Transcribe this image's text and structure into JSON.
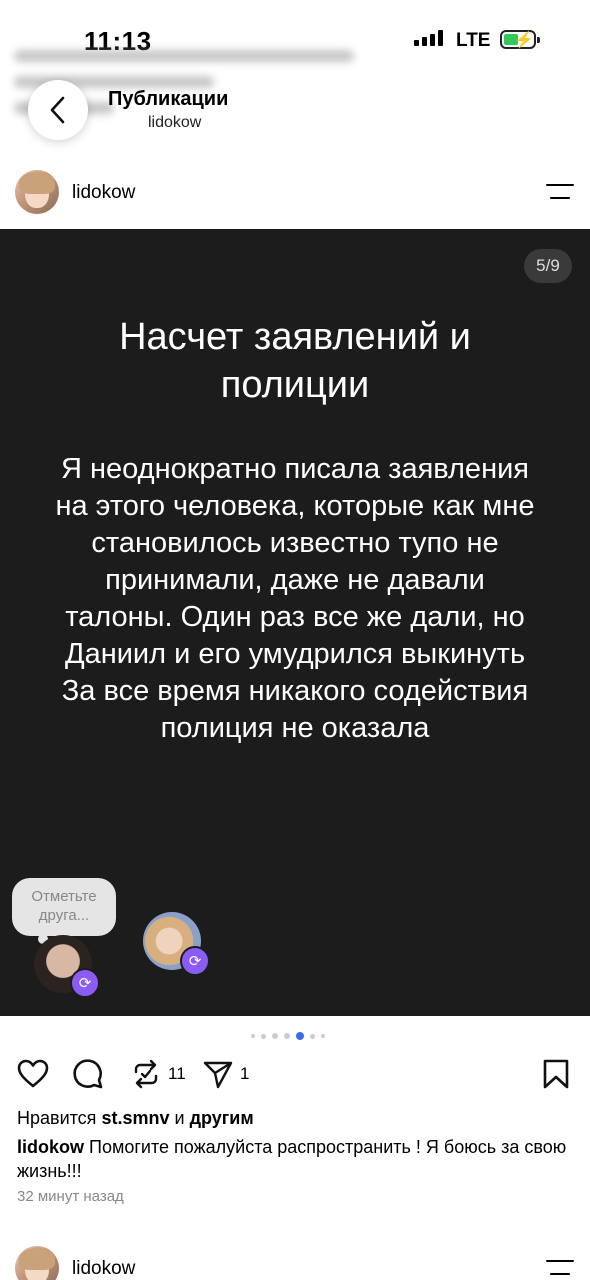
{
  "status_bar": {
    "time": "11:13",
    "network": "LTE"
  },
  "header": {
    "title": "Публикации",
    "subtitle": "lidokow"
  },
  "post": {
    "username": "lidokow",
    "slide": {
      "counter": "5/9",
      "title": "Насчет заявлений и полиции",
      "body": "Я неоднократно писала заявления на этого человека, которые как мне становилось известно тупо не принимали, даже не давали талоны. Один раз все же дали, но Даниил и его умудрился выкинуть За все время никакого содействия полиция не оказала",
      "tag_prompt": "Отметьте друга...",
      "current_slide": 5,
      "total_slides": 9
    },
    "actions": {
      "reposts": "11",
      "shares": "1"
    },
    "likes": {
      "prefix": "Нравится",
      "user": "st.smnv",
      "joiner": "и",
      "others": "другим"
    },
    "caption": {
      "author": "lidokow",
      "text": "Помогите пожалуйста распространить ! Я боюсь за свою жизнь!!!"
    },
    "time_ago": "32 минут назад"
  },
  "next_post": {
    "username": "lidokow"
  },
  "icons": [
    "back-chevron-icon",
    "menu-icon",
    "heart-icon",
    "comment-icon",
    "repost-icon",
    "share-icon",
    "bookmark-icon",
    "remix-icon"
  ],
  "colors": {
    "slide_bg": "#1c1c1c",
    "accent_dot": "#3a6ee8",
    "remix_badge": "#8a5cf5"
  }
}
